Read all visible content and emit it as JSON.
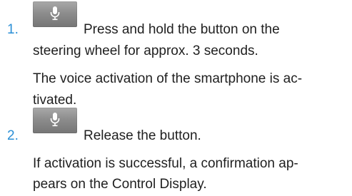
{
  "steps": [
    {
      "number": "1.",
      "button_icon": "microphone-icon",
      "instruction_line1": "Press and hold the button on the",
      "instruction_line2": "steering wheel for approx. 3 seconds.",
      "result_line1": "The voice activation of the smartphone is ac-",
      "result_line2": "tivated."
    },
    {
      "number": "2.",
      "button_icon": "microphone-icon",
      "instruction_line1": "Release the button.",
      "result_line1": "If activation is successful, a confirmation ap-",
      "result_line2": "pears on the Control Display."
    }
  ],
  "colors": {
    "step_number": "#2a8fd6",
    "text": "#1f1f1f",
    "button": "#8d8d8d"
  }
}
